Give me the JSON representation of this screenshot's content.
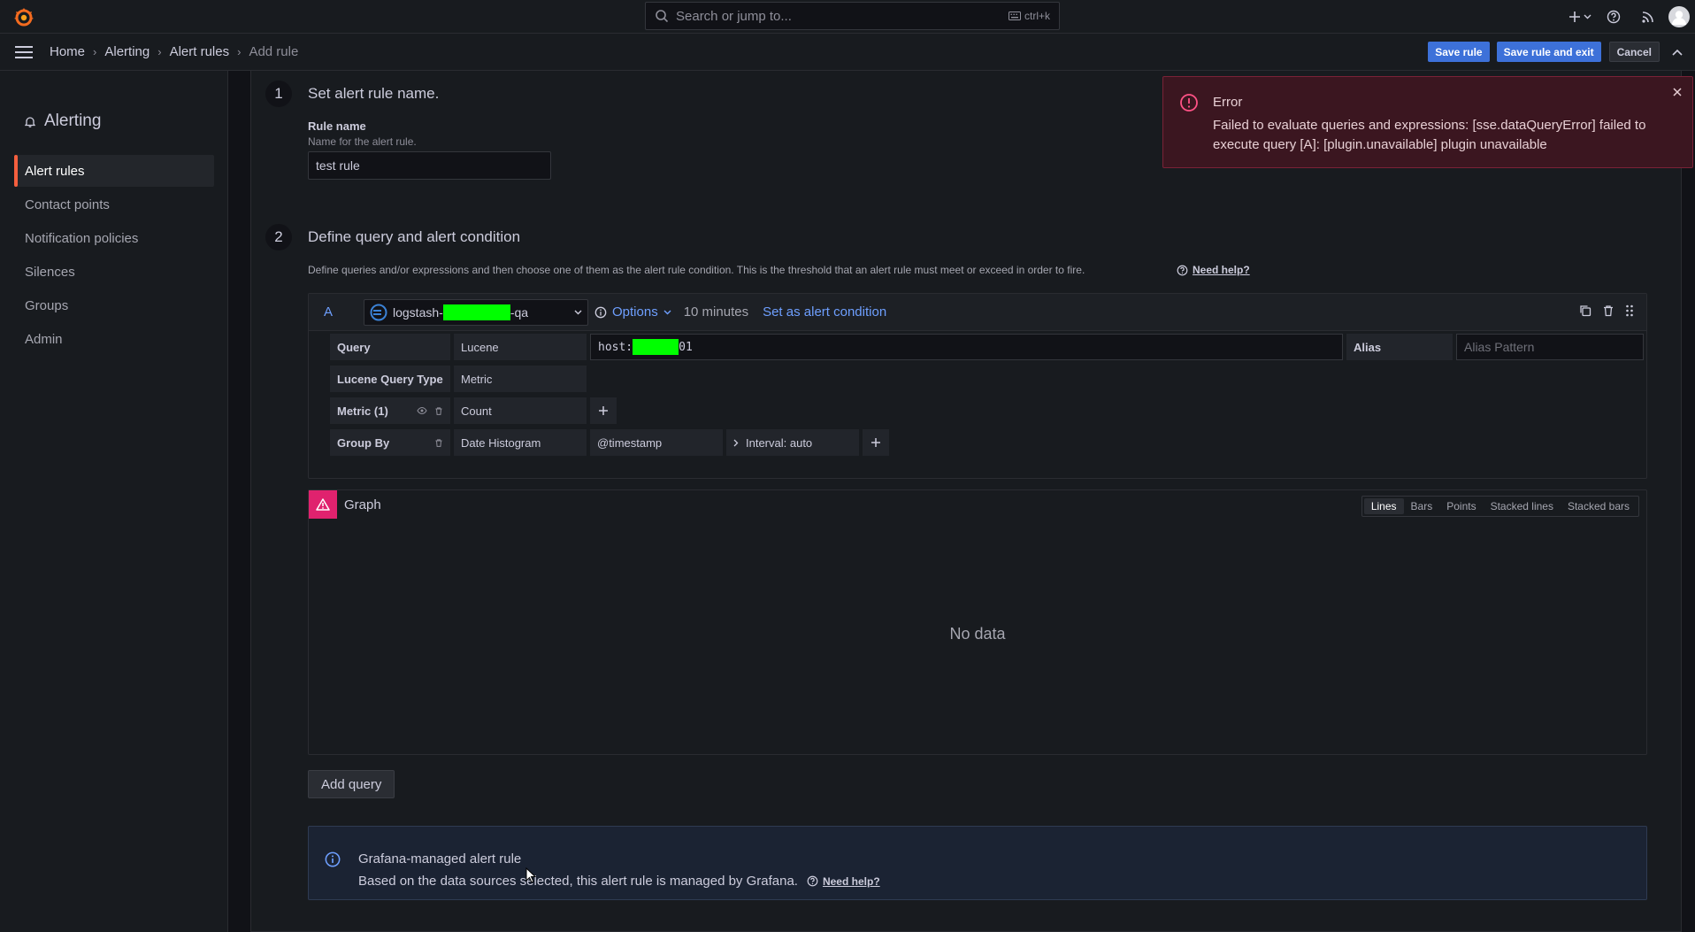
{
  "colors": {
    "accent": "#3d71d9",
    "brand_orange": "#f55f3e",
    "link_blue": "#6e9fff",
    "error_bg": "#3b1620",
    "warning_pink": "#e0226e",
    "redaction_green": "#00ff00"
  },
  "topbar": {
    "search_placeholder": "Search or jump to...",
    "search_shortcut": "ctrl+k",
    "icons": [
      "grafana-logo-icon",
      "plus-icon",
      "help-icon",
      "rss-icon",
      "user-avatar-icon"
    ]
  },
  "breadcrumb": [
    "Home",
    "Alerting",
    "Alert rules",
    "Add rule"
  ],
  "actions": {
    "save": "Save rule",
    "save_exit": "Save rule and exit",
    "cancel": "Cancel"
  },
  "sidebar": {
    "title": "Alerting",
    "items": [
      {
        "label": "Alert rules",
        "active": true
      },
      {
        "label": "Contact points",
        "active": false
      },
      {
        "label": "Notification policies",
        "active": false
      },
      {
        "label": "Silences",
        "active": false
      },
      {
        "label": "Groups",
        "active": false
      },
      {
        "label": "Admin",
        "active": false
      }
    ]
  },
  "step1": {
    "num": "1",
    "title": "Set alert rule name.",
    "field_label": "Rule name",
    "field_desc": "Name for the alert rule.",
    "value": "test rule"
  },
  "step2": {
    "num": "2",
    "title": "Define query and alert condition",
    "desc": "Define queries and/or expressions and then choose one of them as the alert rule condition. This is the threshold that an alert rule must meet or exceed in order to fire.",
    "need_help": "Need help?"
  },
  "query": {
    "letter": "A",
    "datasource_prefix": "logstash-",
    "datasource_suffix": "-qa",
    "options_label": "Options",
    "time_range": "10 minutes",
    "set_condition": "Set as alert condition",
    "rows": {
      "query_label": "Query",
      "query_type": "Lucene",
      "query_prefix": "host:",
      "query_suffix": "01",
      "alias_label": "Alias",
      "alias_placeholder": "Alias Pattern",
      "lucene_type_label": "Lucene Query Type",
      "lucene_type_value": "Metric",
      "metric_label": "Metric (1)",
      "metric_value": "Count",
      "group_by_label": "Group By",
      "group_by_value": "Date Histogram",
      "group_by_field": "@timestamp",
      "interval": "Interval: auto"
    }
  },
  "graph": {
    "title": "Graph",
    "viz_options": [
      "Lines",
      "Bars",
      "Points",
      "Stacked lines",
      "Stacked bars"
    ],
    "active_viz": "Lines",
    "empty": "No data"
  },
  "add_query": "Add query",
  "info": {
    "title": "Grafana-managed alert rule",
    "body": "Based on the data sources selected, this alert rule is managed by Grafana.",
    "need_help": "Need help?"
  },
  "toast": {
    "title": "Error",
    "message": "Failed to evaluate queries and expressions: [sse.dataQueryError] failed to execute query [A]: [plugin.unavailable] plugin unavailable"
  }
}
